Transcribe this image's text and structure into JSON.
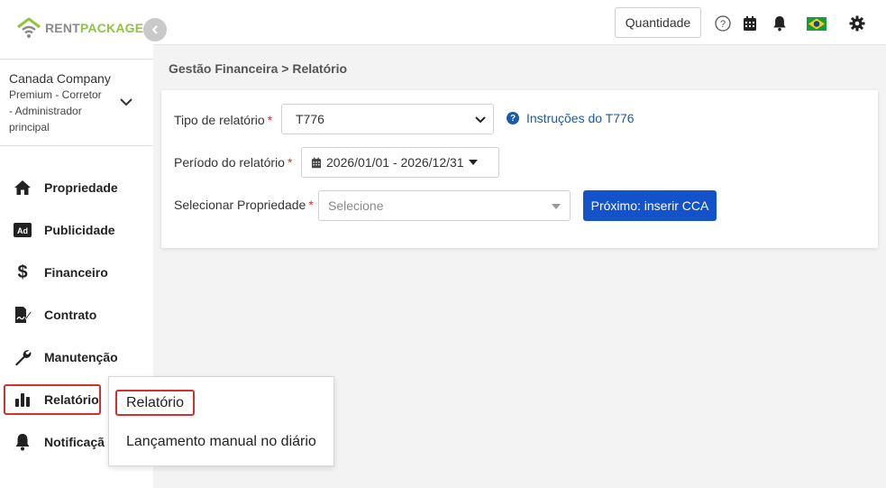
{
  "brand": {
    "name_part1": "RENT",
    "name_part2": "PACKAGE",
    "color_gray": "#8a8a8a",
    "color_green": "#8cc63f"
  },
  "account": {
    "company": "Canada Company",
    "role_line1": "Premium - Corretor",
    "role_line2": "- Administrador",
    "role_line3": "principal"
  },
  "sidebar": {
    "items": [
      {
        "label": "Propriedade",
        "icon": "home-icon"
      },
      {
        "label": "Publicidade",
        "icon": "ad-icon"
      },
      {
        "label": "Financeiro",
        "icon": "dollar-icon"
      },
      {
        "label": "Contrato",
        "icon": "contract-icon"
      },
      {
        "label": "Manutenção",
        "icon": "wrench-icon"
      },
      {
        "label": "Relatório",
        "icon": "bar-chart-icon",
        "active": true
      },
      {
        "label": "Notificaçã",
        "icon": "bell-icon"
      }
    ]
  },
  "topbar": {
    "quantity_label": "Quantidade",
    "icons": [
      "help-circle-icon",
      "calendar-icon",
      "bell-icon",
      "brazil-flag-icon",
      "gear-icon"
    ]
  },
  "breadcrumb": {
    "parent": "Gestão Financeira",
    "separator": " > ",
    "current": "Relatório"
  },
  "form": {
    "report_type_label": "Tipo de relatório",
    "report_type_value": "T776",
    "instructions_link": "Instruções do T776",
    "period_label": "Período do relatório",
    "period_value": "2026/01/01 - 2026/12/31",
    "property_label": "Selecionar Propriedade",
    "property_placeholder": "Selecione",
    "required_mark": "*",
    "next_button": "Próximo: inserir CCA"
  },
  "popup_menu": {
    "items": [
      "Relatório",
      "Lançamento manual no diário"
    ]
  },
  "colors": {
    "primary": "#1352c9",
    "link": "#1a5aa8",
    "highlight": "#d0312d"
  }
}
